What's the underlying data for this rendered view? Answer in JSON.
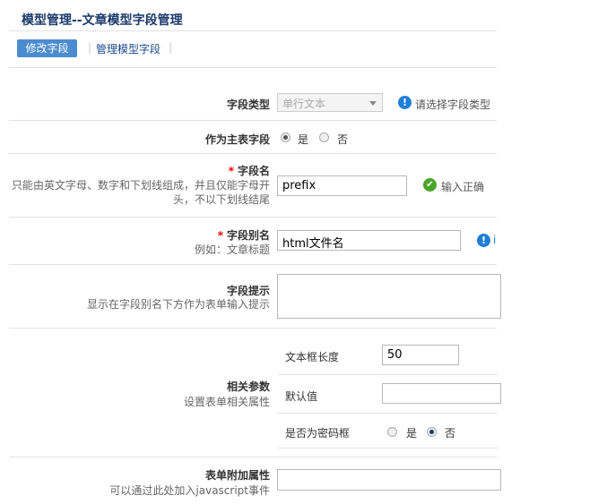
{
  "page": {
    "title": "模型管理--文章模型字段管理"
  },
  "tabs": [
    {
      "label": "修改字段"
    },
    {
      "label": "管理模型字段"
    }
  ],
  "form": {
    "field_type": {
      "label": "字段类型",
      "selected": "单行文本",
      "hint": "请选择字段类型"
    },
    "main_table": {
      "label": "作为主表字段",
      "opt_yes": "是",
      "opt_no": "否",
      "selected": "yes"
    },
    "field_name": {
      "label": "字段名",
      "desc": "只能由英文字母、数字和下划线组成，并且仅能字母开头，不以下划线结尾",
      "value": "prefix",
      "status": "输入正确"
    },
    "field_alias": {
      "label": "字段别名",
      "desc": "例如：文章标题",
      "value": "html文件名",
      "hint_char": "i"
    },
    "field_tip": {
      "label": "字段提示",
      "desc": "显示在字段别名下方作为表单输入提示",
      "value": ""
    },
    "params": {
      "label": "相关参数",
      "desc": "设置表单相关属性",
      "length_label": "文本框长度",
      "length_value": "50",
      "default_label": "默认值",
      "default_value": "",
      "password_label": "是否为密码框",
      "opt_yes": "是",
      "opt_no": "否",
      "password_selected": "no"
    },
    "extra_attr": {
      "label": "表单附加属性",
      "desc": "可以通过此处加入javascript事件",
      "value": ""
    }
  }
}
